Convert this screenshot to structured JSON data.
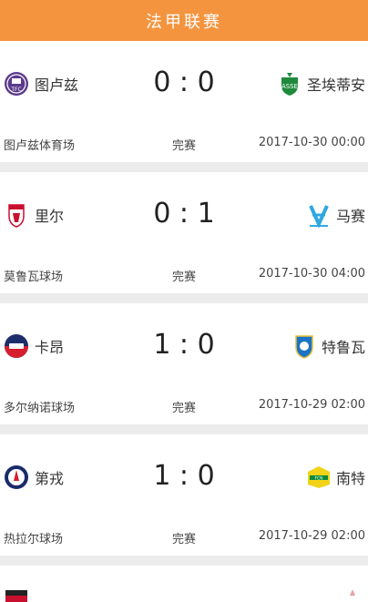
{
  "header": {
    "title": "法甲联赛"
  },
  "matches": [
    {
      "home": "图卢兹",
      "away": "圣埃蒂安",
      "score": "0 : 0",
      "venue": "图卢兹体育场",
      "status": "完赛",
      "time": "2017-10-30 00:00",
      "home_logo": "toulouse-logo",
      "away_logo": "saint-etienne-logo"
    },
    {
      "home": "里尔",
      "away": "马赛",
      "score": "0 : 1",
      "venue": "莫鲁瓦球场",
      "status": "完赛",
      "time": "2017-10-30 04:00",
      "home_logo": "lille-logo",
      "away_logo": "marseille-logo"
    },
    {
      "home": "卡昂",
      "away": "特鲁瓦",
      "score": "1 : 0",
      "venue": "多尔纳诺球场",
      "status": "完赛",
      "time": "2017-10-29 02:00",
      "home_logo": "caen-logo",
      "away_logo": "troyes-logo"
    },
    {
      "home": "第戎",
      "away": "南特",
      "score": "1 : 0",
      "venue": "热拉尔球场",
      "status": "完赛",
      "time": "2017-10-29 02:00",
      "home_logo": "dijon-logo",
      "away_logo": "nantes-logo"
    }
  ],
  "colors": {
    "header_bg": "#f5943f",
    "page_bg": "#ececec",
    "card_bg": "#ffffff"
  }
}
